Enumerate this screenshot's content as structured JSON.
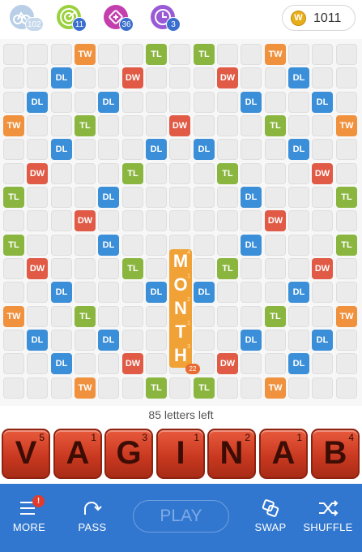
{
  "powerups": [
    {
      "name": "swap-plus",
      "count": "102",
      "color": "#b8cfe7"
    },
    {
      "name": "word-radar",
      "count": "11",
      "color": "#9bd13f"
    },
    {
      "name": "tile-shuffle-pro",
      "count": "36",
      "color": "#c43fae"
    },
    {
      "name": "hindsight",
      "count": "3",
      "color": "#9a5ad6"
    }
  ],
  "coins": {
    "value": "1011",
    "symbol": "W"
  },
  "board": {
    "bonus_squares": [
      {
        "row": 0,
        "col": 3,
        "type": "TW"
      },
      {
        "row": 0,
        "col": 6,
        "type": "TL"
      },
      {
        "row": 0,
        "col": 8,
        "type": "TL"
      },
      {
        "row": 0,
        "col": 11,
        "type": "TW"
      },
      {
        "row": 1,
        "col": 2,
        "type": "DL"
      },
      {
        "row": 1,
        "col": 5,
        "type": "DW"
      },
      {
        "row": 1,
        "col": 9,
        "type": "DW"
      },
      {
        "row": 1,
        "col": 12,
        "type": "DL"
      },
      {
        "row": 2,
        "col": 1,
        "type": "DL"
      },
      {
        "row": 2,
        "col": 4,
        "type": "DL"
      },
      {
        "row": 2,
        "col": 10,
        "type": "DL"
      },
      {
        "row": 2,
        "col": 13,
        "type": "DL"
      },
      {
        "row": 3,
        "col": 0,
        "type": "TW"
      },
      {
        "row": 3,
        "col": 3,
        "type": "TL"
      },
      {
        "row": 3,
        "col": 7,
        "type": "DW"
      },
      {
        "row": 3,
        "col": 11,
        "type": "TL"
      },
      {
        "row": 3,
        "col": 14,
        "type": "TW"
      },
      {
        "row": 4,
        "col": 2,
        "type": "DL"
      },
      {
        "row": 4,
        "col": 6,
        "type": "DL"
      },
      {
        "row": 4,
        "col": 8,
        "type": "DL"
      },
      {
        "row": 4,
        "col": 12,
        "type": "DL"
      },
      {
        "row": 5,
        "col": 1,
        "type": "DW"
      },
      {
        "row": 5,
        "col": 5,
        "type": "TL"
      },
      {
        "row": 5,
        "col": 9,
        "type": "TL"
      },
      {
        "row": 5,
        "col": 13,
        "type": "DW"
      },
      {
        "row": 6,
        "col": 0,
        "type": "TL"
      },
      {
        "row": 6,
        "col": 4,
        "type": "DL"
      },
      {
        "row": 6,
        "col": 10,
        "type": "DL"
      },
      {
        "row": 6,
        "col": 14,
        "type": "TL"
      },
      {
        "row": 7,
        "col": 3,
        "type": "DW"
      },
      {
        "row": 7,
        "col": 11,
        "type": "DW"
      },
      {
        "row": 8,
        "col": 0,
        "type": "TL"
      },
      {
        "row": 8,
        "col": 4,
        "type": "DL"
      },
      {
        "row": 8,
        "col": 10,
        "type": "DL"
      },
      {
        "row": 8,
        "col": 14,
        "type": "TL"
      },
      {
        "row": 9,
        "col": 1,
        "type": "DW"
      },
      {
        "row": 9,
        "col": 5,
        "type": "TL"
      },
      {
        "row": 9,
        "col": 9,
        "type": "TL"
      },
      {
        "row": 9,
        "col": 13,
        "type": "DW"
      },
      {
        "row": 10,
        "col": 2,
        "type": "DL"
      },
      {
        "row": 10,
        "col": 6,
        "type": "DL"
      },
      {
        "row": 10,
        "col": 8,
        "type": "DL"
      },
      {
        "row": 10,
        "col": 12,
        "type": "DL"
      },
      {
        "row": 11,
        "col": 0,
        "type": "TW"
      },
      {
        "row": 11,
        "col": 3,
        "type": "TL"
      },
      {
        "row": 11,
        "col": 11,
        "type": "TL"
      },
      {
        "row": 11,
        "col": 14,
        "type": "TW"
      },
      {
        "row": 12,
        "col": 1,
        "type": "DL"
      },
      {
        "row": 12,
        "col": 4,
        "type": "DL"
      },
      {
        "row": 12,
        "col": 10,
        "type": "DL"
      },
      {
        "row": 12,
        "col": 13,
        "type": "DL"
      },
      {
        "row": 13,
        "col": 2,
        "type": "DL"
      },
      {
        "row": 13,
        "col": 5,
        "type": "DW"
      },
      {
        "row": 13,
        "col": 9,
        "type": "DW"
      },
      {
        "row": 13,
        "col": 12,
        "type": "DL"
      },
      {
        "row": 14,
        "col": 3,
        "type": "TW"
      },
      {
        "row": 14,
        "col": 6,
        "type": "TL"
      },
      {
        "row": 14,
        "col": 8,
        "type": "TL"
      },
      {
        "row": 14,
        "col": 11,
        "type": "TW"
      }
    ],
    "played_word": {
      "word": "MONTH",
      "letters": [
        {
          "letter": "M",
          "points": "4"
        },
        {
          "letter": "O",
          "points": "1"
        },
        {
          "letter": "N",
          "points": "2"
        },
        {
          "letter": "T",
          "points": "1"
        },
        {
          "letter": "H",
          "points": "3"
        }
      ],
      "score": "22"
    }
  },
  "letters_left_text": "85 letters left",
  "rack": [
    {
      "letter": "V",
      "points": "5"
    },
    {
      "letter": "A",
      "points": "1"
    },
    {
      "letter": "G",
      "points": "3"
    },
    {
      "letter": "I",
      "points": "1"
    },
    {
      "letter": "N",
      "points": "2"
    },
    {
      "letter": "A",
      "points": "1"
    },
    {
      "letter": "B",
      "points": "4"
    }
  ],
  "bottom": {
    "more_label": "MORE",
    "more_badge": "!",
    "pass_label": "PASS",
    "play_label": "PLAY",
    "swap_label": "SWAP",
    "shuffle_label": "SHUFFLE"
  }
}
